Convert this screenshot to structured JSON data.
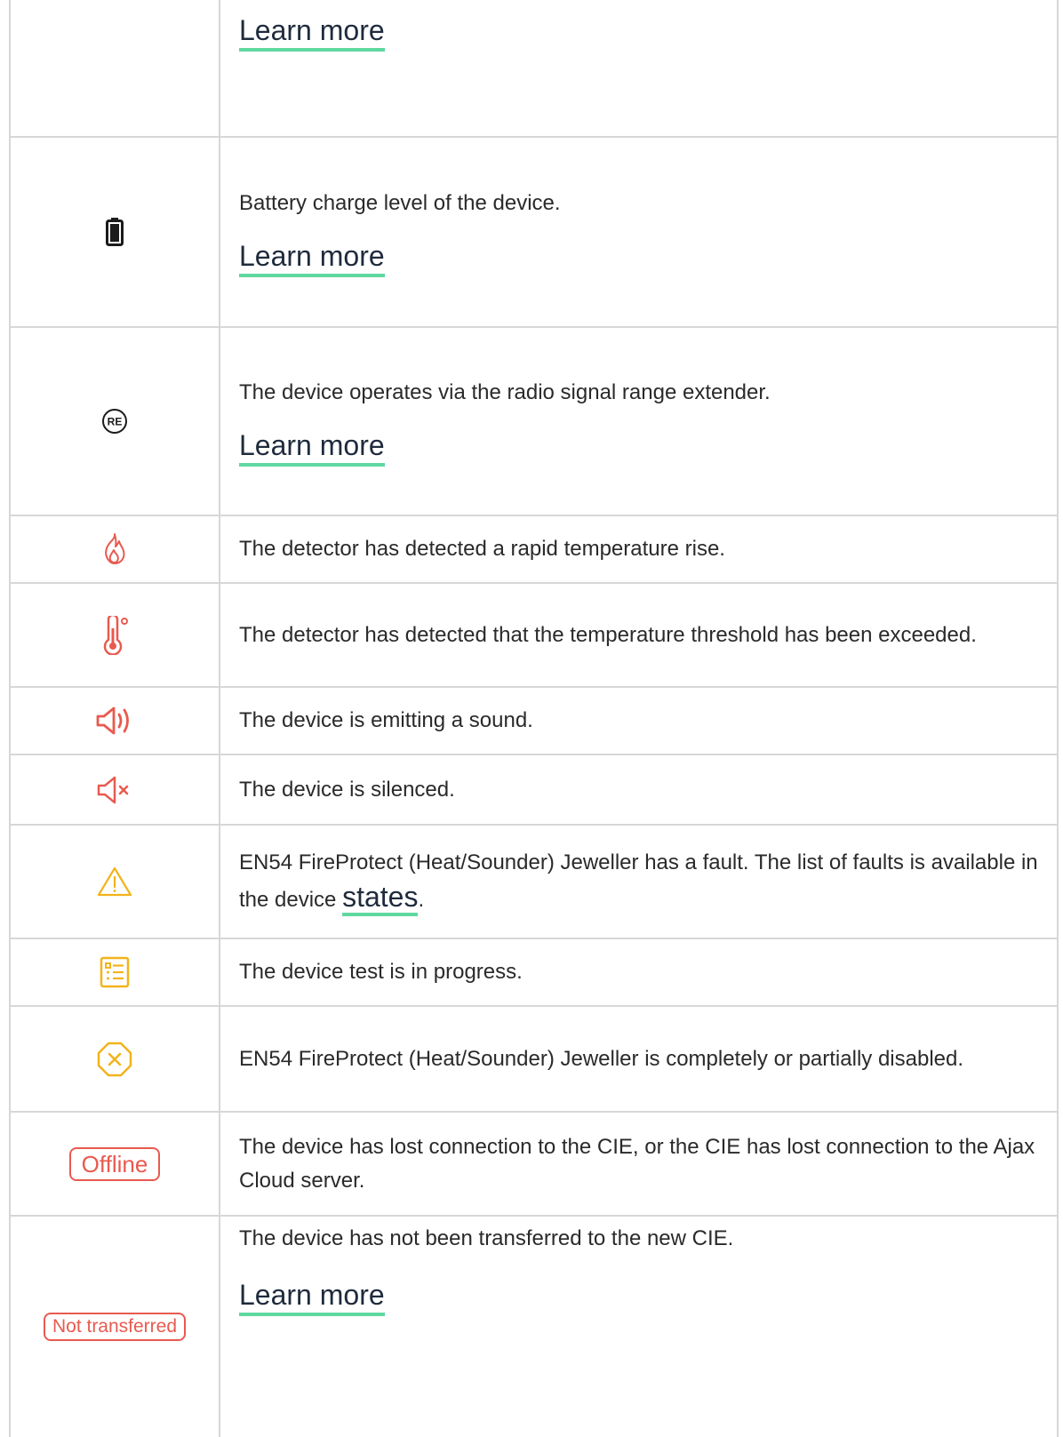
{
  "rows": [
    {
      "icon": "none",
      "desc": "",
      "link": "Learn more"
    },
    {
      "icon": "battery-icon",
      "desc": "Battery charge level of the device.",
      "link": "Learn more"
    },
    {
      "icon": "range-extender-icon",
      "icon_text": "RE",
      "desc": "The device operates via the radio signal range extender.",
      "link": "Learn more"
    },
    {
      "icon": "flame-icon",
      "desc": "The detector has detected a rapid temperature rise."
    },
    {
      "icon": "thermometer-icon",
      "desc": "The detector has detected that the temperature threshold has been exceeded."
    },
    {
      "icon": "speaker-sound-icon",
      "desc": "The device is emitting a sound."
    },
    {
      "icon": "speaker-muted-icon",
      "desc": "The device is silenced."
    },
    {
      "icon": "warning-icon",
      "desc_before": "EN54 FireProtect (Heat/Sounder) Jeweller has a fault. The list of faults is available in the device ",
      "desc_link": "states",
      "desc_after": "."
    },
    {
      "icon": "test-list-icon",
      "desc": "The device test is in progress."
    },
    {
      "icon": "disabled-icon",
      "desc": "EN54 FireProtect (Heat/Sounder) Jeweller is completely or partially disabled."
    },
    {
      "icon": "offline-badge",
      "badge": "Offline",
      "desc": "The device has lost connection to the CIE, or the CIE has lost connection to the Ajax Cloud server."
    },
    {
      "icon": "not-transferred-badge",
      "badge": "Not transferred",
      "desc": "The device has not been transferred to the new CIE.",
      "link": "Learn more"
    }
  ],
  "colors": {
    "accent": "#5fd8a0",
    "alert": "#e85a4f",
    "warning": "#f2b31a",
    "border": "#d7d7d7"
  }
}
